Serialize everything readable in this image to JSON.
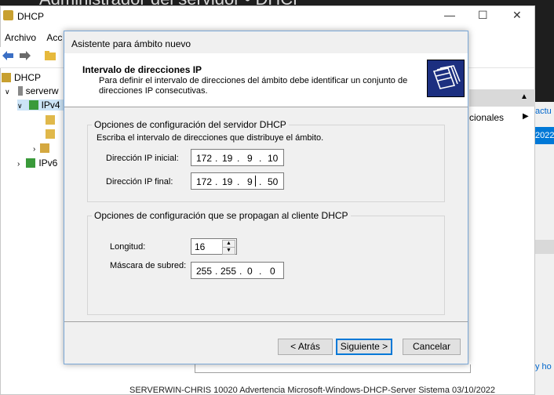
{
  "background": {
    "title": "Administrador del servidor • DHCP",
    "window_title": "DHCP",
    "menu": [
      "Archivo",
      "Acc"
    ],
    "tree": {
      "root": "DHCP",
      "server": "serverw",
      "ipv4": "IPv4",
      "ipv6": "IPv6"
    },
    "right_pane": {
      "actions_label": "cionales",
      "side_text_1": "actu",
      "side_text_2": "2022",
      "side_text_3": "y ho"
    },
    "status_row": "SERVERWIN-CHRIS    10020  Advertencia  Microsoft-Windows-DHCP-Server  Sistema   03/10/2022"
  },
  "dialog": {
    "title": "Asistente para ámbito nuevo",
    "header_title": "Intervalo de direcciones IP",
    "header_desc": "Para definir el intervalo de direcciones del ámbito debe identificar un conjunto de direcciones IP consecutivas.",
    "group1": {
      "legend": "Opciones de configuración del servidor DHCP",
      "instruction": "Escriba el intervalo de direcciones que distribuye el ámbito.",
      "start_label": "Dirección IP inicial:",
      "start_ip": [
        "172",
        "19",
        "9",
        "10"
      ],
      "end_label": "Dirección IP final:",
      "end_ip": [
        "172",
        "19",
        "9",
        "50"
      ]
    },
    "group2": {
      "legend": "Opciones de configuración que se propagan al cliente DHCP",
      "length_label": "Longitud:",
      "length_value": "16",
      "mask_label": "Máscara de subred:",
      "mask": [
        "255",
        "255",
        "0",
        "0"
      ]
    },
    "buttons": {
      "back": "< Atrás",
      "next": "Siguiente >",
      "cancel": "Cancelar"
    }
  }
}
